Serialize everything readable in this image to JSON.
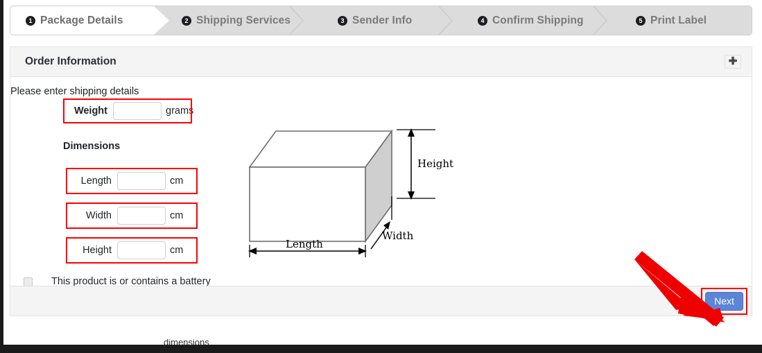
{
  "steps": [
    {
      "num": "1",
      "label": "Package Details",
      "active": true
    },
    {
      "num": "2",
      "label": "Shipping Services",
      "active": false
    },
    {
      "num": "3",
      "label": "Sender Info",
      "active": false
    },
    {
      "num": "4",
      "label": "Confirm Shipping",
      "active": false
    },
    {
      "num": "5",
      "label": "Print Label",
      "active": false
    }
  ],
  "card": {
    "title": "Order Information",
    "expand_icon": "plus-icon",
    "expand_glyph": "✚"
  },
  "form": {
    "intro": "Please enter shipping details",
    "dimensions_heading": "Dimensions",
    "weight": {
      "label": "Weight",
      "value": "",
      "placeholder": "",
      "unit": "grams"
    },
    "length": {
      "label": "Length",
      "value": "",
      "placeholder": "",
      "unit": "cm"
    },
    "width": {
      "label": "Width",
      "value": "",
      "placeholder": "",
      "unit": "cm"
    },
    "height": {
      "label": "Height",
      "value": "",
      "placeholder": "",
      "unit": "cm"
    },
    "battery": {
      "label": "This product is or contains a battery",
      "checked": false
    }
  },
  "diagram": {
    "height_label": "Height",
    "length_label": "Length",
    "width_label": "Width"
  },
  "footer": {
    "next_label": "Next"
  },
  "annotations": {
    "highlight_color": "#ff0000",
    "arrow_color": "#ee0000",
    "accent_button_color": "#5b85d6"
  },
  "bottom_cut_text": "dimensions"
}
